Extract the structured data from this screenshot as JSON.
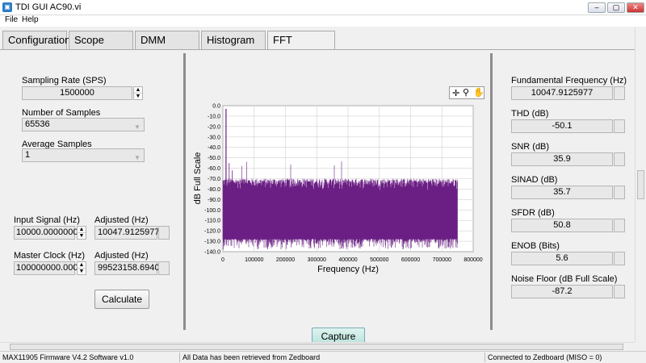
{
  "window": {
    "title": "TDI GUI AC90.vi",
    "icon": "vi-icon",
    "min_label": "‒",
    "max_label": "▢",
    "close_label": "✕"
  },
  "menu": {
    "items": [
      "File",
      "Help"
    ]
  },
  "tabs": [
    "Configuration",
    "Scope",
    "DMM",
    "Histogram",
    "FFT"
  ],
  "active_tab": "FFT",
  "left": {
    "sampling_rate": {
      "label": "Sampling Rate (SPS)",
      "value": "1500000"
    },
    "num_samples": {
      "label": "Number of Samples",
      "value": "65536"
    },
    "avg_samples": {
      "label": "Average Samples",
      "value": "1"
    },
    "input_signal": {
      "label": "Input Signal (Hz)",
      "value": "10000.0000000",
      "adjusted_label": "Adjusted (Hz)",
      "adjusted_value": "10047.9125977"
    },
    "master_clock": {
      "label": "Master Clock (Hz)",
      "value": "100000000.000",
      "adjusted_label": "Adjusted (Hz)",
      "adjusted_value": "99523158.6940"
    },
    "calculate_label": "Calculate"
  },
  "right": {
    "metrics": [
      {
        "label": "Fundamental Frequency (Hz)",
        "value": "10047.9125977"
      },
      {
        "label": "THD (dB)",
        "value": "-50.1"
      },
      {
        "label": "SNR (dB)",
        "value": "35.9"
      },
      {
        "label": "SINAD (dB)",
        "value": "35.7"
      },
      {
        "label": "SFDR (dB)",
        "value": "50.8"
      },
      {
        "label": "ENOB (Bits)",
        "value": "5.6"
      },
      {
        "label": "Noise Floor (dB Full Scale)",
        "value": "-87.2"
      }
    ]
  },
  "capture_label": "Capture",
  "status": {
    "left": "MAX11905 Firmware V4.2 Software v1.0",
    "middle": "All Data has been retrieved from Zedboard",
    "right": "Connected to Zedboard (MISO = 0)"
  },
  "chart_data": {
    "type": "line",
    "xlabel": "Frequency (Hz)",
    "ylabel": "dB Full Scale",
    "xlim": [
      0,
      800000
    ],
    "ylim": [
      -140,
      0
    ],
    "x_ticks": [
      0,
      100000,
      200000,
      300000,
      400000,
      500000,
      600000,
      700000,
      800000
    ],
    "y_ticks": [
      "0.0",
      "-10.0",
      "-20.0",
      "-30.0",
      "-40.0",
      "-50.0",
      "-60.0",
      "-70.0",
      "-80.0",
      "-90.0",
      "-100.0",
      "-110.0",
      "-120.0",
      "-130.0",
      "-140.0"
    ],
    "grid": true,
    "color": "#6b1f84",
    "fundamental": {
      "x": 10047.9,
      "y": -3
    },
    "noise_band": {
      "x_start": 0,
      "x_end": 750000,
      "typical_low": -128,
      "typical_high": -70,
      "peak_high": -59,
      "min_low": -138
    },
    "harmonics": [
      {
        "x": 20096,
        "y": -55
      },
      {
        "x": 30144,
        "y": -62
      }
    ],
    "toolbar_icons": [
      "crosshair-icon",
      "zoom-icon",
      "pan-icon"
    ]
  }
}
